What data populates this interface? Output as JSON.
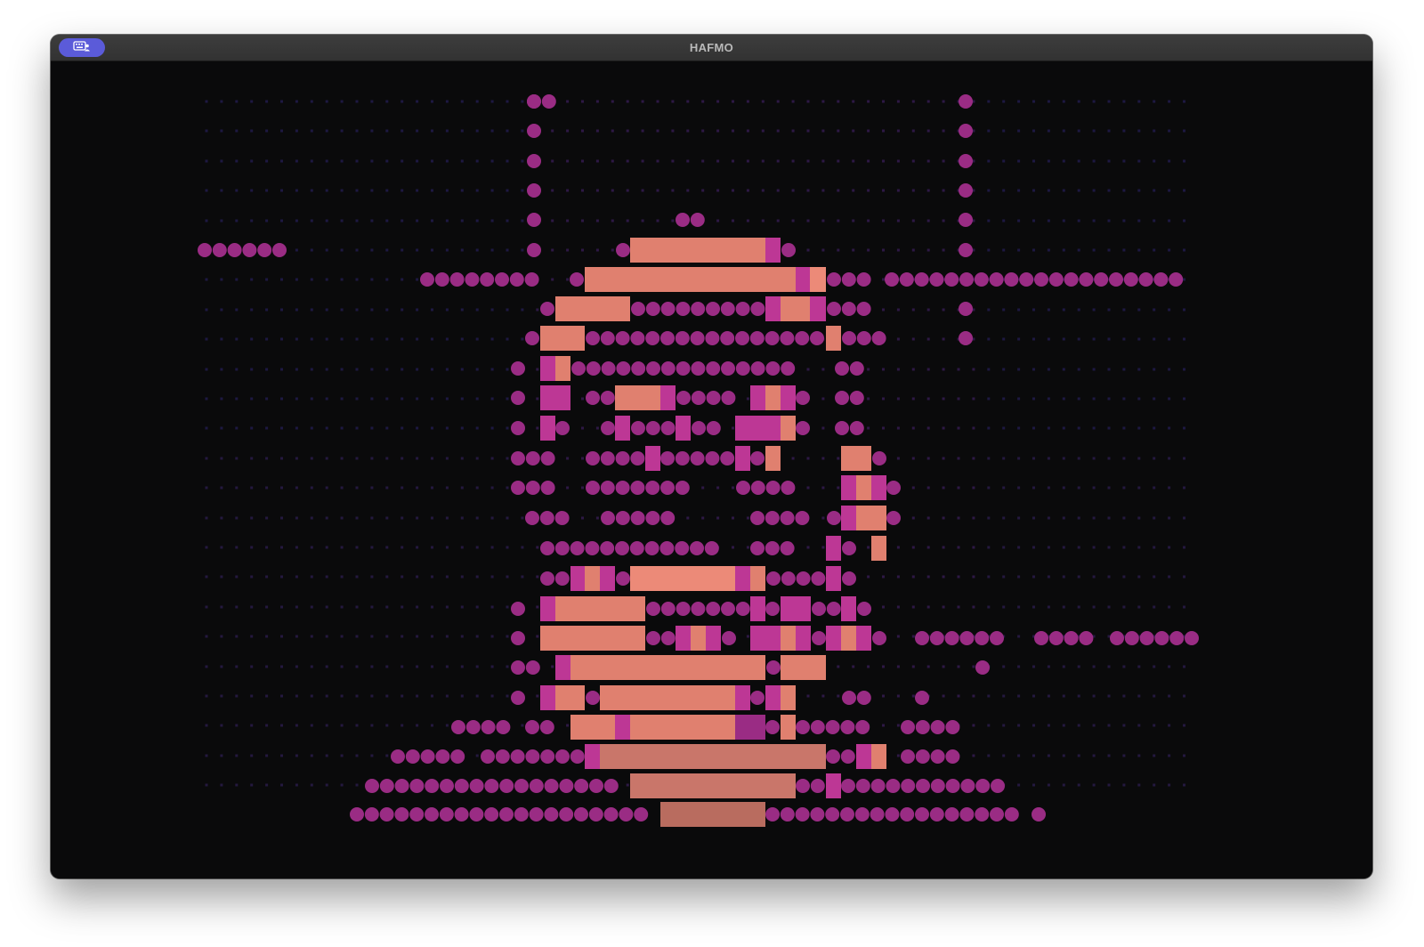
{
  "window": {
    "title": "HAFMO",
    "app_icon": "keyboard-person-icon",
    "background": "#0a0a0b",
    "accent": "#5b5bd9"
  },
  "artwork": {
    "description_colors": {
      "dot_dim_blue": "#2a2466",
      "dot_dim_purple": "#4a1e62",
      "dot_bright": "#9a2c84",
      "block_magenta": "#c13a9a",
      "block_salmon": "#e0806f",
      "block_peach": "#ee8a78"
    }
  }
}
